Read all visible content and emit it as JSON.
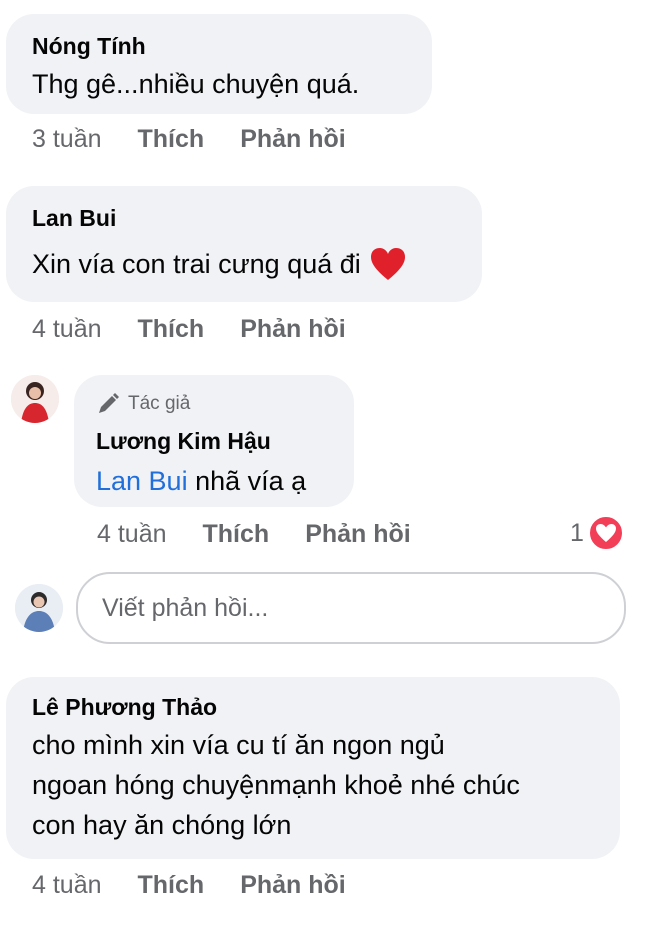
{
  "comments": [
    {
      "name": "Nóng Tính",
      "text": "Thg gê...nhiều chuyện quá.",
      "time": "3 tuần",
      "like": "Thích",
      "reply": "Phản hồi"
    },
    {
      "name": "Lan Bui",
      "text": "Xin vía con trai cưng quá đi",
      "time": "4 tuần",
      "like": "Thích",
      "reply": "Phản hồi"
    }
  ],
  "author_reply": {
    "badge": "Tác giả",
    "name": "Lương Kim Hậu",
    "mention": "Lan Bui",
    "text": " nhã vía ạ",
    "time": "4 tuần",
    "like": "Thích",
    "reply": "Phản hồi",
    "reaction_count": "1"
  },
  "reply_box": {
    "placeholder": "Viết phản hồi..."
  },
  "last_comment": {
    "name": "Lê Phương Thảo",
    "lines": [
      "cho mình xin vía cu tí  ăn ngon ngủ",
      "ngoan hóng chuyệnmạnh khoẻ nhé chúc",
      "con hay ăn chóng lớn"
    ],
    "time": "4 tuần",
    "like": "Thích",
    "reply": "Phản hồi"
  },
  "colors": {
    "bubble": "#f0f2f5",
    "meta": "#65676b",
    "mention": "#216fdb",
    "heart": "#f33e58"
  }
}
